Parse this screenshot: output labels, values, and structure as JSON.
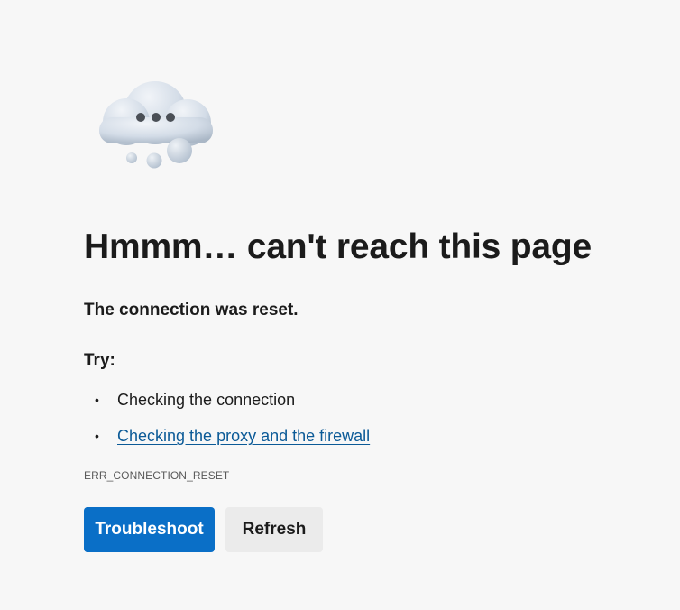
{
  "error_page": {
    "icon": "cloud-thinking-icon",
    "title": "Hmmm… can't reach this page",
    "subtitle": "The connection was reset.",
    "try_heading": "Try:",
    "suggestions": [
      {
        "text": "Checking the connection",
        "is_link": false
      },
      {
        "text": "Checking the proxy and the firewall",
        "is_link": true
      }
    ],
    "error_code": "ERR_CONNECTION_RESET",
    "buttons": {
      "troubleshoot": "Troubleshoot",
      "refresh": "Refresh"
    }
  },
  "colors": {
    "background": "#f7f7f7",
    "primary_button": "#0a6fc7",
    "secondary_button": "#ebebeb",
    "link": "#0b5a97",
    "text": "#1b1b1b"
  }
}
